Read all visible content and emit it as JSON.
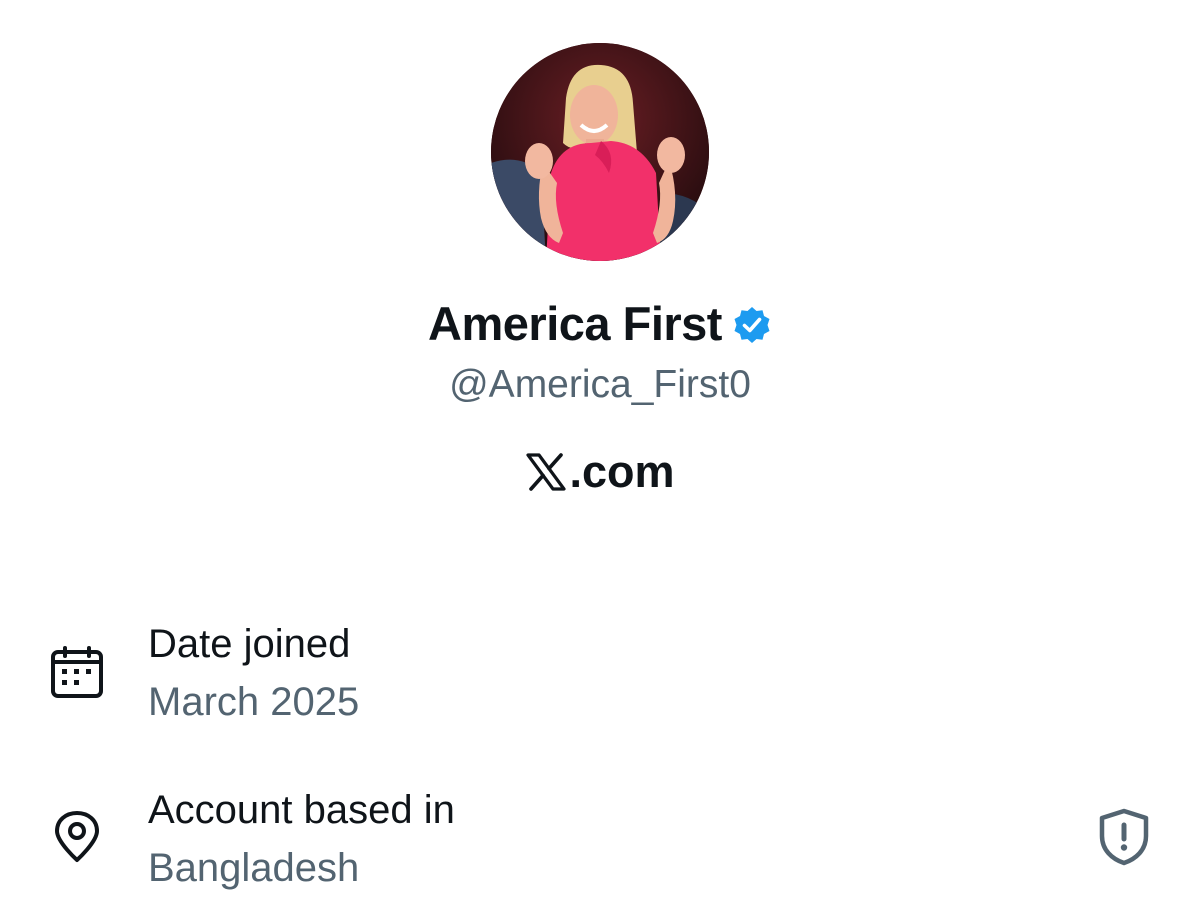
{
  "profile": {
    "display_name": "America First",
    "verified": true,
    "handle": "@America_First0",
    "domain": ".com",
    "avatar_icon": "profile-photo"
  },
  "about": {
    "date_joined_label": "Date joined",
    "date_joined_value": "March 2025",
    "date_icon": "calendar-icon",
    "location_label": "Account based in",
    "location_value": "Bangladesh",
    "location_icon": "location-pin-icon",
    "shield_icon": "shield-alert-icon"
  },
  "colors": {
    "verified_blue": "#1d9bf0",
    "text_primary": "#0f1419",
    "text_secondary": "#536471"
  }
}
